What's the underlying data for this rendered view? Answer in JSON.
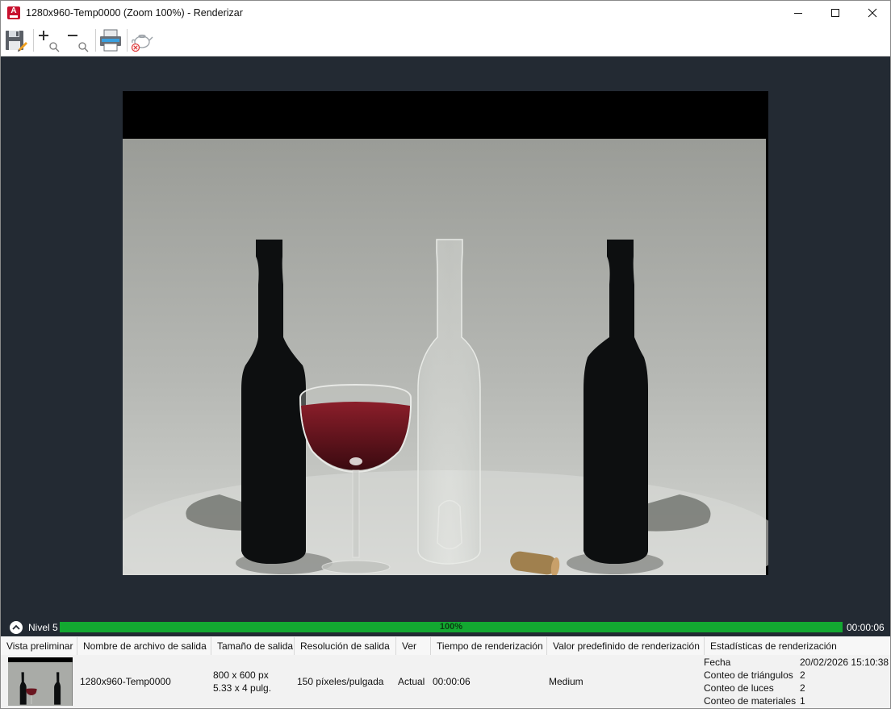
{
  "window": {
    "title": "1280x960-Temp0000 (Zoom 100%) - Renderizar",
    "app_icon": "autocad-icon"
  },
  "toolbar": {
    "buttons": [
      {
        "name": "save-icon"
      },
      {
        "name": "zoom-in-icon"
      },
      {
        "name": "zoom-out-icon"
      },
      {
        "name": "print-icon"
      },
      {
        "name": "cancel-render-icon"
      }
    ]
  },
  "progress": {
    "level_label": "Nivel 5",
    "percent_label": "100%",
    "percent_value": 100,
    "time_label": "00:00:06"
  },
  "table": {
    "columns": [
      "Vista preliminar",
      "Nombre de archivo de salida",
      "Tamaño de salida",
      "Resolución de salida",
      "Ver",
      "Tiempo de renderización",
      "Valor predefinido de renderización",
      "Estadísticas de renderización"
    ],
    "row": {
      "filename": "1280x960-Temp0000",
      "size_px": "800 x 600 px",
      "size_in": "5.33 x 4 pulg.",
      "resolution": "150 píxeles/pulgada",
      "view": "Actual",
      "render_time": "00:00:06",
      "preset": "Medium",
      "stats": [
        {
          "label": "Fecha",
          "value": "20/02/2026 15:10:38"
        },
        {
          "label": "Conteo de triángulos",
          "value": "2"
        },
        {
          "label": "Conteo de luces",
          "value": "2"
        },
        {
          "label": "Conteo de materiales",
          "value": "1"
        }
      ]
    }
  },
  "colors": {
    "viewport_bg": "#232a33",
    "progress_green": "#13a831",
    "app_red": "#c8102e"
  }
}
